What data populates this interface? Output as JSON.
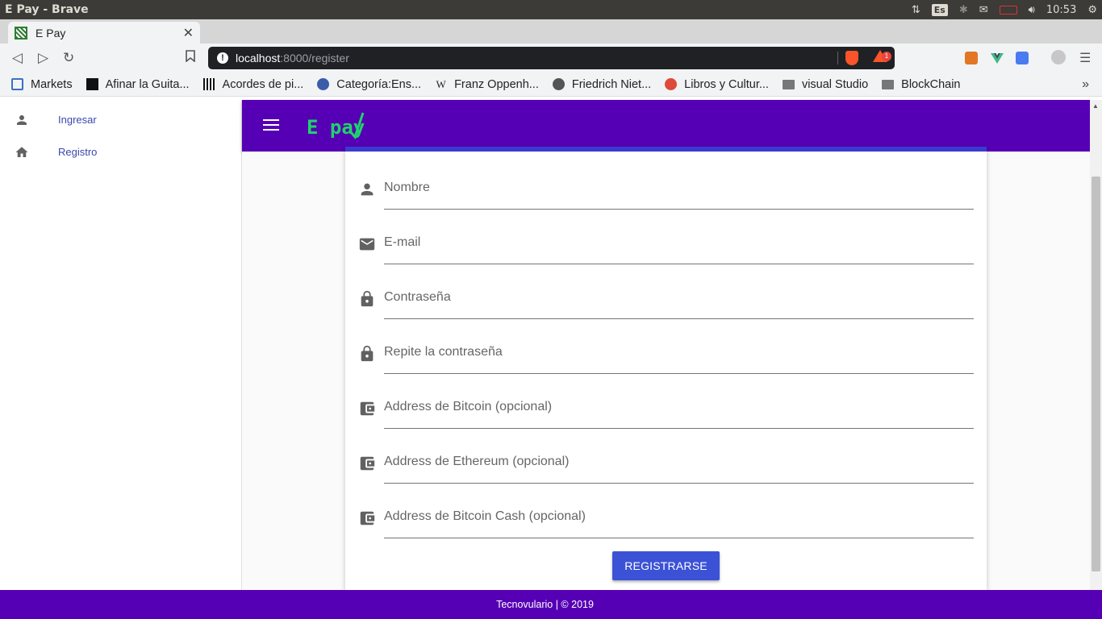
{
  "os": {
    "window_title": "E Pay - Brave",
    "keyboard_layout": "Es",
    "clock": "10:53"
  },
  "browser": {
    "tab_title": "E Pay",
    "url_host": "localhost",
    "url_path": ":8000/register",
    "rewards_badge": "1",
    "bookmarks": [
      {
        "label": "Markets",
        "icon": "markets-icon"
      },
      {
        "label": "Afinar la Guita...",
        "icon": "guitar-site-icon"
      },
      {
        "label": "Acordes de pi...",
        "icon": "piano-icon"
      },
      {
        "label": "Categoría:Ens...",
        "icon": "wikipedia-icon"
      },
      {
        "label": "Franz Oppenh...",
        "icon": "wikipedia-w-icon"
      },
      {
        "label": "Friedrich Niet...",
        "icon": "globe-icon"
      },
      {
        "label": "Libros y Cultur...",
        "icon": "google-plus-icon"
      },
      {
        "label": "visual Studio",
        "icon": "folder-icon"
      },
      {
        "label": "BlockChain",
        "icon": "folder-icon"
      }
    ]
  },
  "sidebar": {
    "items": [
      {
        "label": "Ingresar",
        "icon": "person-icon"
      },
      {
        "label": "Registro",
        "icon": "home-icon"
      }
    ]
  },
  "app": {
    "logo_text": "E pay",
    "brand_color": "#5600b5",
    "logo_color": "#1fd36b"
  },
  "form": {
    "fields": [
      {
        "label": "Nombre",
        "icon": "person-icon"
      },
      {
        "label": "E-mail",
        "icon": "mail-icon"
      },
      {
        "label": "Contraseña",
        "icon": "lock-icon"
      },
      {
        "label": "Repite la contraseña",
        "icon": "lock-icon"
      },
      {
        "label": "Address de Bitcoin (opcional)",
        "icon": "wallet-icon"
      },
      {
        "label": "Address de Ethereum (opcional)",
        "icon": "wallet-icon"
      },
      {
        "label": "Address de Bitcoin Cash (opcional)",
        "icon": "wallet-icon"
      }
    ],
    "submit_label": "REGISTRARSE",
    "button_color": "#3c52d6"
  },
  "footer": {
    "text": "Tecnovulario | © 2019"
  }
}
